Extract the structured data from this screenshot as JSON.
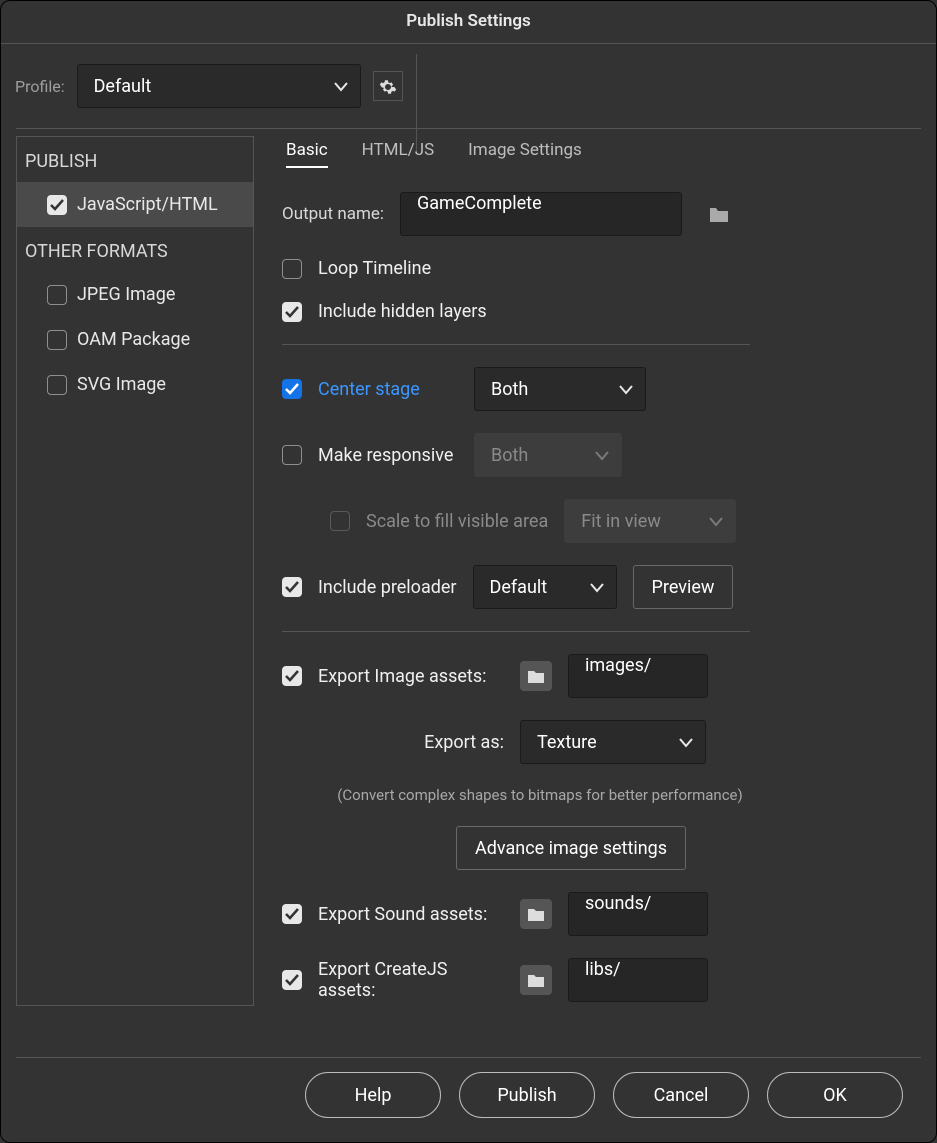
{
  "title": "Publish Settings",
  "profile": {
    "label": "Profile:",
    "value": "Default"
  },
  "sidebar": {
    "heading_publish": "PUBLISH",
    "heading_other": "OTHER FORMATS",
    "items_publish": [
      {
        "label": "JavaScript/HTML",
        "checked": true,
        "selected": true
      }
    ],
    "items_other": [
      {
        "label": "JPEG Image",
        "checked": false
      },
      {
        "label": "OAM Package",
        "checked": false
      },
      {
        "label": "SVG Image",
        "checked": false
      }
    ]
  },
  "tabs": [
    {
      "label": "Basic",
      "active": true
    },
    {
      "label": "HTML/JS",
      "active": false
    },
    {
      "label": "Image Settings",
      "active": false
    }
  ],
  "output": {
    "label": "Output name:",
    "value": "GameComplete"
  },
  "options": {
    "loop_timeline": {
      "label": "Loop Timeline",
      "checked": false
    },
    "include_hidden": {
      "label": "Include hidden layers",
      "checked": true
    },
    "center_stage": {
      "label": "Center stage",
      "checked": true,
      "value": "Both"
    },
    "make_responsive": {
      "label": "Make responsive",
      "checked": false,
      "value": "Both"
    },
    "scale_fill": {
      "label": "Scale to fill visible area",
      "checked": false,
      "value": "Fit in view"
    },
    "include_preloader": {
      "label": "Include preloader",
      "checked": true,
      "value": "Default",
      "preview": "Preview"
    },
    "export_image": {
      "label": "Export Image assets:",
      "checked": true,
      "path": "images/"
    },
    "export_as": {
      "label": "Export as:",
      "value": "Texture"
    },
    "hint": "(Convert complex shapes to bitmaps for better performance)",
    "advance_btn": "Advance image settings",
    "export_sound": {
      "label": "Export Sound assets:",
      "checked": true,
      "path": "sounds/"
    },
    "export_createjs": {
      "label": "Export CreateJS assets:",
      "checked": true,
      "path": "libs/"
    }
  },
  "footer": {
    "help": "Help",
    "publish": "Publish",
    "cancel": "Cancel",
    "ok": "OK"
  }
}
